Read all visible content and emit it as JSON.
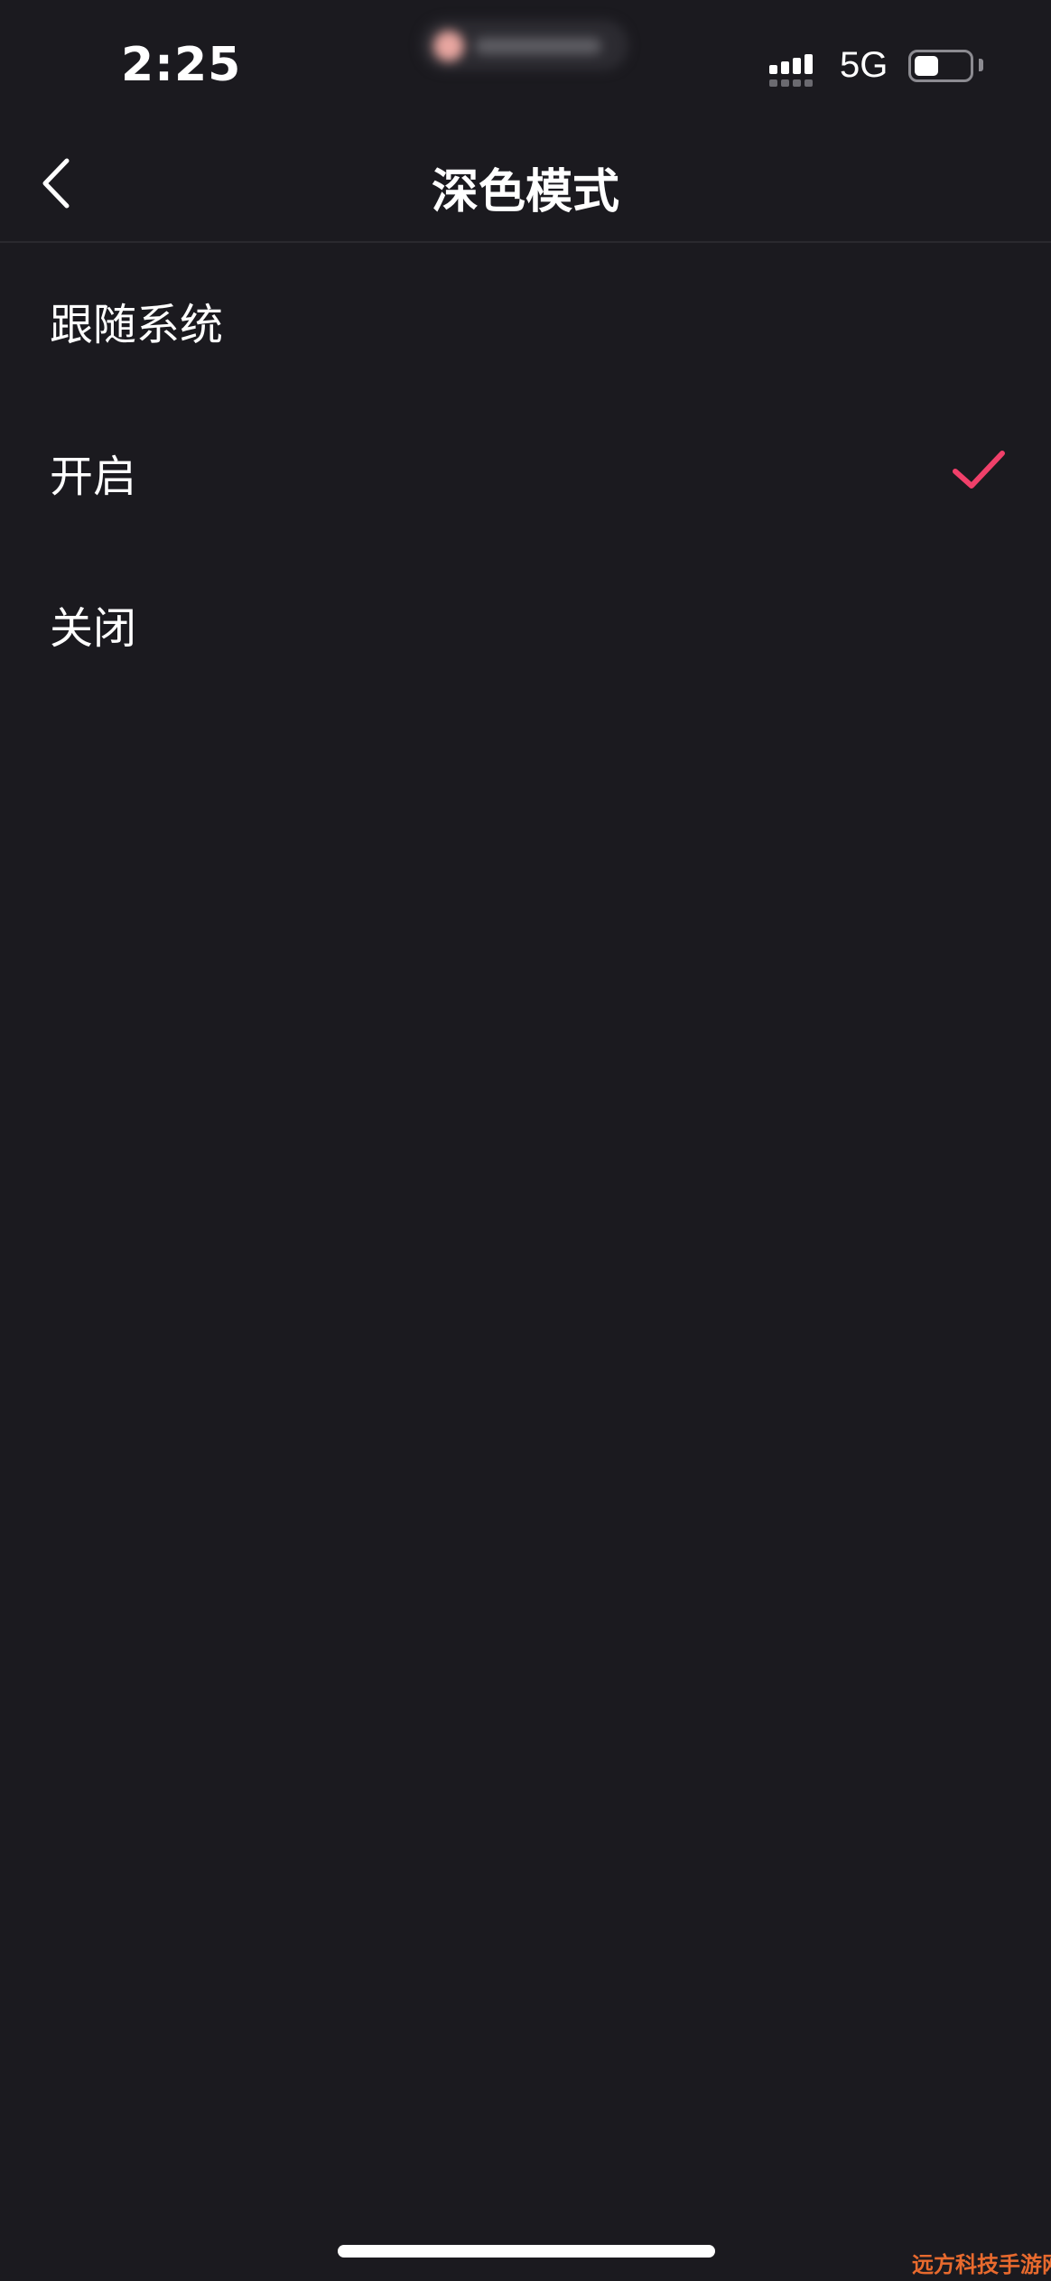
{
  "status_bar": {
    "time": "2:25",
    "network": "5G"
  },
  "header": {
    "title": "深色模式"
  },
  "options": [
    {
      "label": "跟随系统",
      "selected": false
    },
    {
      "label": "开启",
      "selected": true
    },
    {
      "label": "关闭",
      "selected": false
    }
  ],
  "icons": {
    "back": "chevron-left-icon",
    "check": "checkmark-icon"
  },
  "colors": {
    "background": "#1b1a1f",
    "accent": "#f0406a",
    "text": "#ffffff"
  },
  "watermark": {
    "text": "远方科技手游网"
  }
}
